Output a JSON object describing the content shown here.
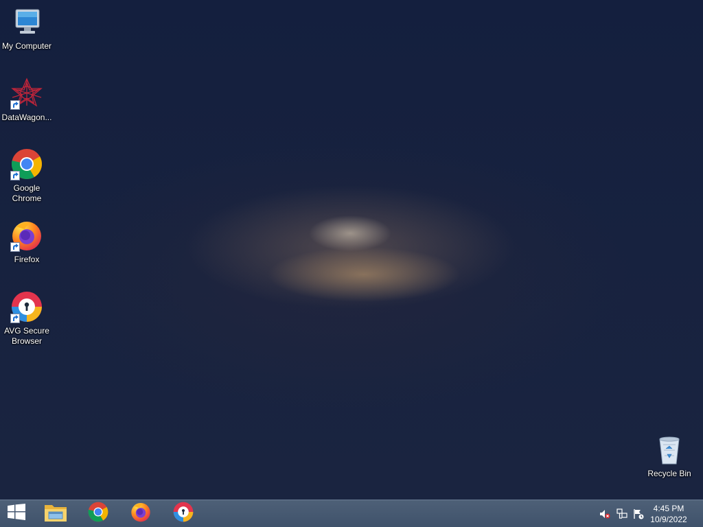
{
  "desktop": {
    "icons": [
      {
        "label": "My Computer",
        "icon": "computer-icon",
        "shortcut": false
      },
      {
        "label": "DataWagon...",
        "icon": "datawagon-icon",
        "shortcut": true
      },
      {
        "label": "Google Chrome",
        "icon": "chrome-icon",
        "shortcut": true
      },
      {
        "label": "Firefox",
        "icon": "firefox-icon",
        "shortcut": true
      },
      {
        "label": "AVG Secure Browser",
        "icon": "avg-browser-icon",
        "shortcut": true
      },
      {
        "label": "Recycle Bin",
        "icon": "recycle-bin-icon",
        "shortcut": false
      }
    ]
  },
  "taskbar": {
    "pinned": [
      {
        "icon": "start-windows-icon"
      },
      {
        "icon": "file-explorer-icon"
      },
      {
        "icon": "chrome-icon"
      },
      {
        "icon": "firefox-icon"
      },
      {
        "icon": "avg-browser-icon"
      }
    ],
    "tray": [
      {
        "icon": "volume-muted-icon"
      },
      {
        "icon": "network-icon"
      },
      {
        "icon": "action-center-flag-icon"
      }
    ],
    "clock": {
      "time": "4:45 PM",
      "date": "10/9/2022"
    }
  },
  "colors": {
    "desktop_bg": "#17223f",
    "taskbar_bg": "#46586f"
  }
}
